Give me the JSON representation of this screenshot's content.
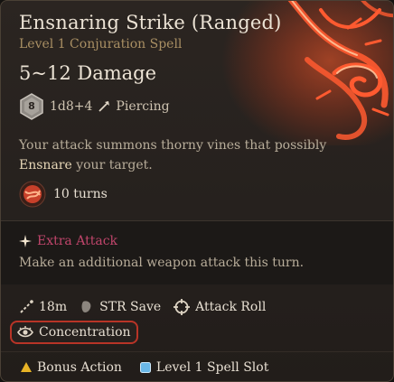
{
  "spell": {
    "title": "Ensnaring Strike (Ranged)",
    "subtitle": "Level 1 Conjuration Spell",
    "damage": "5~12 Damage",
    "die_label": "8",
    "dice": "1d8+4",
    "damage_type": "Piercing",
    "description_before": "Your attack summons thorny vines that possibly ",
    "description_keyword": "Ensnare",
    "description_after": " your target.",
    "duration": "10 turns"
  },
  "extra_attack": {
    "title": "Extra Attack",
    "description": "Make an additional weapon attack this turn."
  },
  "properties": {
    "range": "18m",
    "save": "STR Save",
    "roll": "Attack Roll",
    "concentration": "Concentration"
  },
  "costs": {
    "action": "Bonus Action",
    "slot": "Level 1 Spell Slot"
  },
  "colors": {
    "title": "#ece3d5",
    "subtitle": "#a98f63",
    "extra_attack": "#c0456b",
    "concentration_border": "#b83427",
    "bonus_action": "#e8b326",
    "spell_slot": "#6ab8e8"
  }
}
